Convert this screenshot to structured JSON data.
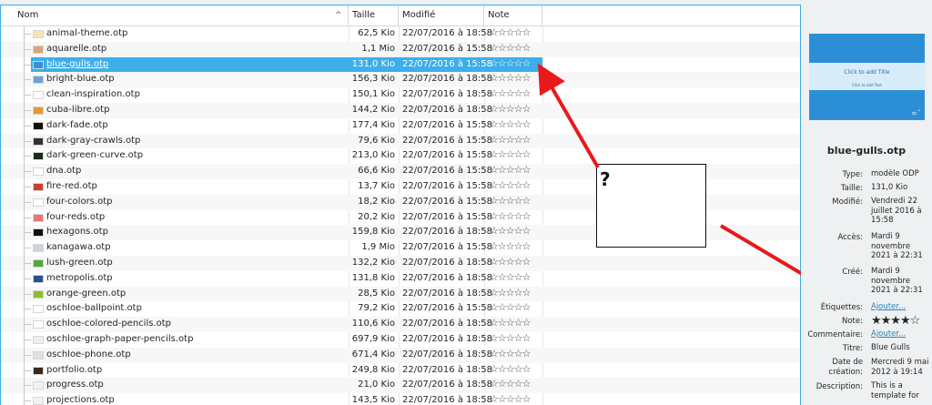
{
  "header": {
    "col_name": "Nom",
    "col_size": "Taille",
    "col_modified": "Modifié",
    "col_note": "Note"
  },
  "files": [
    {
      "name": "animal-theme.otp",
      "size": "62,5 Kio",
      "date": "22/07/2016 à 18:58",
      "rating": "☆☆☆☆☆",
      "thumb": "#f6e3b2"
    },
    {
      "name": "aquarelle.otp",
      "size": "1,1 Mio",
      "date": "22/07/2016 à 15:58",
      "rating": "☆☆☆☆☆",
      "thumb": "#d9a679"
    },
    {
      "name": "blue-gulls.otp",
      "size": "131,0 Kio",
      "date": "22/07/2016 à 15:58",
      "rating": "☆☆☆☆☆",
      "thumb": "#3a8fd5",
      "selected": true
    },
    {
      "name": "bright-blue.otp",
      "size": "156,3 Kio",
      "date": "22/07/2016 à 18:58",
      "rating": "☆☆☆☆☆",
      "thumb": "#6da2d6"
    },
    {
      "name": "clean-inspiration.otp",
      "size": "150,1 Kio",
      "date": "22/07/2016 à 18:58",
      "rating": "☆☆☆☆☆",
      "thumb": "#ffffff"
    },
    {
      "name": "cuba-libre.otp",
      "size": "144,2 Kio",
      "date": "22/07/2016 à 18:58",
      "rating": "☆☆☆☆☆",
      "thumb": "#e59a2a"
    },
    {
      "name": "dark-fade.otp",
      "size": "177,4 Kio",
      "date": "22/07/2016 à 15:58",
      "rating": "☆☆☆☆☆",
      "thumb": "#111111"
    },
    {
      "name": "dark-gray-crawls.otp",
      "size": "79,6 Kio",
      "date": "22/07/2016 à 15:58",
      "rating": "☆☆☆☆☆",
      "thumb": "#333333"
    },
    {
      "name": "dark-green-curve.otp",
      "size": "213,0 Kio",
      "date": "22/07/2016 à 15:58",
      "rating": "☆☆☆☆☆",
      "thumb": "#1a2b1a"
    },
    {
      "name": "dna.otp",
      "size": "66,6 Kio",
      "date": "22/07/2016 à 15:58",
      "rating": "☆☆☆☆☆",
      "thumb": "#ffffff"
    },
    {
      "name": "fire-red.otp",
      "size": "13,7 Kio",
      "date": "22/07/2016 à 15:58",
      "rating": "☆☆☆☆☆",
      "thumb": "#d23a2a"
    },
    {
      "name": "four-colors.otp",
      "size": "18,2 Kio",
      "date": "22/07/2016 à 15:58",
      "rating": "☆☆☆☆☆",
      "thumb": "#ffffff"
    },
    {
      "name": "four-reds.otp",
      "size": "20,2 Kio",
      "date": "22/07/2016 à 15:58",
      "rating": "☆☆☆☆☆",
      "thumb": "#e87474"
    },
    {
      "name": "hexagons.otp",
      "size": "159,8 Kio",
      "date": "22/07/2016 à 18:58",
      "rating": "☆☆☆☆☆",
      "thumb": "#101010"
    },
    {
      "name": "kanagawa.otp",
      "size": "1,9 Mio",
      "date": "22/07/2016 à 15:58",
      "rating": "☆☆☆☆☆",
      "thumb": "#cdd5dc"
    },
    {
      "name": "lush-green.otp",
      "size": "132,2 Kio",
      "date": "22/07/2016 à 18:58",
      "rating": "☆☆☆☆☆",
      "thumb": "#5aa33a"
    },
    {
      "name": "metropolis.otp",
      "size": "131,8 Kio",
      "date": "22/07/2016 à 18:58",
      "rating": "☆☆☆☆☆",
      "thumb": "#2a4f8f"
    },
    {
      "name": "orange-green.otp",
      "size": "28,5 Kio",
      "date": "22/07/2016 à 18:58",
      "rating": "☆☆☆☆☆",
      "thumb": "#8bbf2a"
    },
    {
      "name": "oschloe-ballpoint.otp",
      "size": "79,2 Kio",
      "date": "22/07/2016 à 15:58",
      "rating": "☆☆☆☆☆",
      "thumb": "#ffffff"
    },
    {
      "name": "oschloe-colored-pencils.otp",
      "size": "110,6 Kio",
      "date": "22/07/2016 à 18:58",
      "rating": "☆☆☆☆☆",
      "thumb": "#ffffff"
    },
    {
      "name": "oschloe-graph-paper-pencils.otp",
      "size": "697,9 Kio",
      "date": "22/07/2016 à 18:58",
      "rating": "☆☆☆☆☆",
      "thumb": "#eeeeee"
    },
    {
      "name": "oschloe-phone.otp",
      "size": "671,4 Kio",
      "date": "22/07/2016 à 18:58",
      "rating": "☆☆☆☆☆",
      "thumb": "#e0e0e0"
    },
    {
      "name": "portfolio.otp",
      "size": "249,8 Kio",
      "date": "22/07/2016 à 18:58",
      "rating": "☆☆☆☆☆",
      "thumb": "#3a2a1a"
    },
    {
      "name": "progress.otp",
      "size": "21,0 Kio",
      "date": "22/07/2016 à 18:58",
      "rating": "☆☆☆☆☆",
      "thumb": "#f2f2f2"
    },
    {
      "name": "projections.otp",
      "size": "143,5 Kio",
      "date": "22/07/2016 à 18:58",
      "rating": "☆☆☆☆☆",
      "thumb": "#f2f2f2"
    }
  ],
  "preview": {
    "title": "Click to add Title",
    "subtitle": "Click to add Text"
  },
  "info": {
    "filename": "blue-gulls.otp",
    "type_label": "Type:",
    "type_value": "modèle ODP",
    "size_label": "Taille:",
    "size_value": "131,0 Kio",
    "modified_label": "Modifié:",
    "modified_value": "Vendredi 22 juillet 2016 à 15:58",
    "accessed_label": "Accès:",
    "accessed_value": "Mardi 9 novembre 2021 à 22:31",
    "created_label": "Créé:",
    "created_value": "Mardi 9 novembre 2021 à 22:31",
    "tags_label": "Étiquettes:",
    "tags_link": "Ajouter...",
    "note_label": "Note:",
    "note_stars": "★★★★☆",
    "note_value": 4,
    "comment_label": "Commentaire:",
    "comment_link": "Ajouter...",
    "title_label": "Titre:",
    "title_value": "Blue Gulls",
    "creation_label": "Date de création:",
    "creation_value": "Mercredi 9 mai 2012 à 19:14",
    "description_label": "Description:",
    "description_value": "This is a template for"
  },
  "annotation": {
    "question": "?"
  },
  "colors": {
    "selection": "#3daee9",
    "arrow": "#e8191b",
    "link": "#2980b9"
  }
}
